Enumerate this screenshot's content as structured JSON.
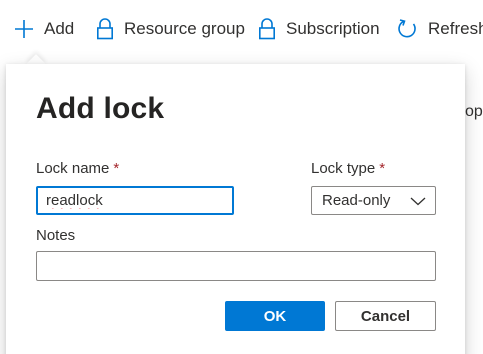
{
  "toolbar": {
    "add_label": "Add",
    "resource_group_label": "Resource group",
    "subscription_label": "Subscription",
    "refresh_label": "Refresh"
  },
  "background": {
    "fragment_text": "op"
  },
  "dialog": {
    "title": "Add lock",
    "lock_name": {
      "label": "Lock name",
      "required_marker": "*",
      "value": "readlock"
    },
    "lock_type": {
      "label": "Lock type",
      "required_marker": "*",
      "selected": "Read-only"
    },
    "notes": {
      "label": "Notes",
      "value": ""
    },
    "ok_label": "OK",
    "cancel_label": "Cancel"
  },
  "colors": {
    "accent": "#0078d4",
    "required": "#a4262c",
    "text": "#323130"
  },
  "icons": {
    "add": "plus-icon",
    "resource_group": "lock-icon",
    "subscription": "lock-icon",
    "refresh": "refresh-icon",
    "dropdown": "chevron-down-icon"
  }
}
